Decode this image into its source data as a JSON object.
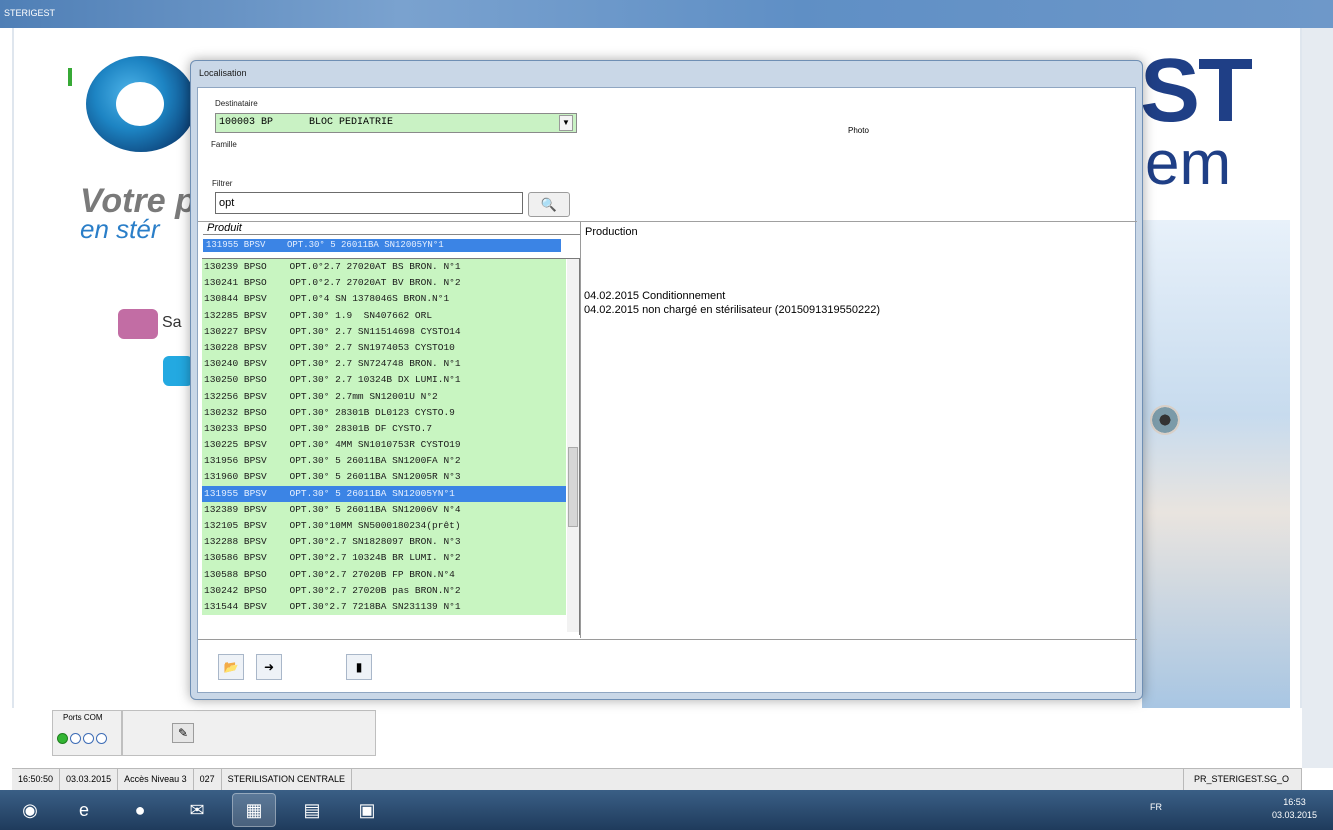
{
  "window": {
    "title": "STERIGEST"
  },
  "background": {
    "brand_line1": "ST",
    "brand_line2": "em",
    "tagline1": "Votre p",
    "tagline2": "en stér",
    "button_label": "Sa"
  },
  "dialog": {
    "title": "Localisation",
    "destinataire_label": "Destinataire",
    "destinataire_value": "100003 BP      BLOC PEDIATRIE",
    "famille_label": "Famille",
    "filtrer_label": "Filtrer",
    "filter_value": "opt",
    "photo_label": "Photo",
    "produit_header": "Produit",
    "selected_top": "131955 BPSV    OPT.30° 5 26011BA SN12005YN°1",
    "products": [
      "130239 BPSO    OPT.0°2.7 27020AT BS BRON. N°1",
      "130241 BPSO    OPT.0°2.7 27020AT BV BRON. N°2",
      "130844 BPSV    OPT.0°4 SN 1378046S BRON.N°1",
      "132285 BPSV    OPT.30° 1.9  SN407662 ORL",
      "130227 BPSV    OPT.30° 2.7 SN11514698 CYSTO14",
      "130228 BPSV    OPT.30° 2.7 SN1974053 CYSTO10",
      "130240 BPSV    OPT.30° 2.7 SN724748 BRON. N°1",
      "130250 BPSO    OPT.30° 2.7 10324B DX LUMI.N°1",
      "132256 BPSV    OPT.30° 2.7mm SN12001U N°2",
      "130232 BPSO    OPT.30° 28301B DL0123 CYSTO.9",
      "130233 BPSO    OPT.30° 28301B DF CYSTO.7",
      "130225 BPSV    OPT.30° 4MM SN1010753R CYSTO19",
      "131956 BPSV    OPT.30° 5 26011BA SN1200FA N°2",
      "131960 BPSV    OPT.30° 5 26011BA SN12005R N°3",
      "131955 BPSV    OPT.30° 5 26011BA SN12005YN°1",
      "132389 BPSV    OPT.30° 5 26011BA SN12006V N°4",
      "132105 BPSV    OPT.30°10MM SN5000180234(prêt)",
      "132288 BPSV    OPT.30°2.7 SN1828097 BRON. N°3",
      "130586 BPSV    OPT.30°2.7 10324B BR LUMI. N°2",
      "130588 BPSO    OPT.30°2.7 27020B FP BRON.N°4",
      "130242 BPSO    OPT.30°2.7 27020B pas BRON.N°2",
      "131544 BPSV    OPT.30°2.7 7218BA SN231139 N°1"
    ],
    "selected_index": 14,
    "production_title": "Production",
    "production_lines": [
      "04.02.2015 Conditionnement",
      "04.02.2015 non chargé en stérilisateur (2015091319550222)"
    ]
  },
  "ports": {
    "label": "Ports COM"
  },
  "statusbar": {
    "time": "16:50:50",
    "date": "03.03.2015",
    "access": "Accès Niveau 3",
    "code": "027",
    "service": "STERILISATION CENTRALE",
    "right": "PR_STERIGEST.SG_O"
  },
  "taskbar": {
    "tray": "FR",
    "clock_time": "16:53",
    "clock_date": "03.03.2015"
  },
  "colors": {
    "list_row_bg": "#c8f5c1",
    "selected_bg": "#3b84e5",
    "dialog_frame": "#c9d7e7",
    "taskbar": "#1f3b5c"
  }
}
